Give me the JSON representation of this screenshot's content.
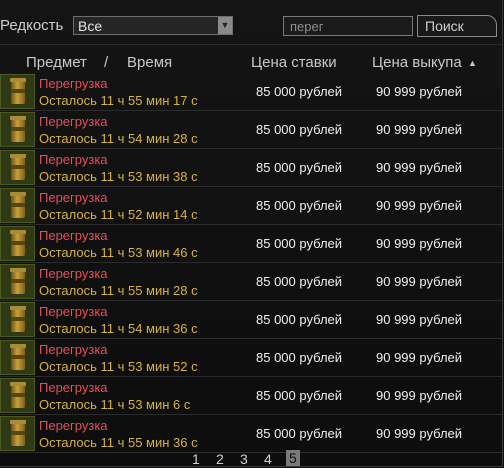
{
  "filter": {
    "rarity_label": "Редкость",
    "rarity_value": "Все",
    "search_value": "перег",
    "search_button": "Поиск"
  },
  "header": {
    "item": "Предмет",
    "separator": "/",
    "time": "Время",
    "bid": "Цена ставки",
    "buyout": "Цена выкупа",
    "sort_indicator": "▲"
  },
  "rows": [
    {
      "name": "Перегрузка",
      "time": "Осталось 11 ч 55 мин 17 с",
      "bid": "85 000 рублей",
      "buyout": "90 999 рублей"
    },
    {
      "name": "Перегрузка",
      "time": "Осталось 11 ч 54 мин 28 с",
      "bid": "85 000 рублей",
      "buyout": "90 999 рублей"
    },
    {
      "name": "Перегрузка",
      "time": "Осталось 11 ч 53 мин 38 с",
      "bid": "85 000 рублей",
      "buyout": "90 999 рублей"
    },
    {
      "name": "Перегрузка",
      "time": "Осталось 11 ч 52 мин 14 с",
      "bid": "85 000 рублей",
      "buyout": "90 999 рублей"
    },
    {
      "name": "Перегрузка",
      "time": "Осталось 11 ч 53 мин 46 с",
      "bid": "85 000 рублей",
      "buyout": "90 999 рублей"
    },
    {
      "name": "Перегрузка",
      "time": "Осталось 11 ч 55 мин 28 с",
      "bid": "85 000 рублей",
      "buyout": "90 999 рублей"
    },
    {
      "name": "Перегрузка",
      "time": "Осталось 11 ч 54 мин 36 с",
      "bid": "85 000 рублей",
      "buyout": "90 999 рублей"
    },
    {
      "name": "Перегрузка",
      "time": "Осталось 11 ч 53 мин 52 с",
      "bid": "85 000 рублей",
      "buyout": "90 999 рублей"
    },
    {
      "name": "Перегрузка",
      "time": "Осталось 11 ч 53 мин 6 с",
      "bid": "85 000 рублей",
      "buyout": "90 999 рублей"
    },
    {
      "name": "Перегрузка",
      "time": "Осталось 11 ч 55 мин 36 с",
      "bid": "85 000 рублей",
      "buyout": "90 999 рублей"
    }
  ],
  "pagination": {
    "pages": [
      "1",
      "2",
      "3",
      "4",
      "5"
    ],
    "current": "5"
  }
}
